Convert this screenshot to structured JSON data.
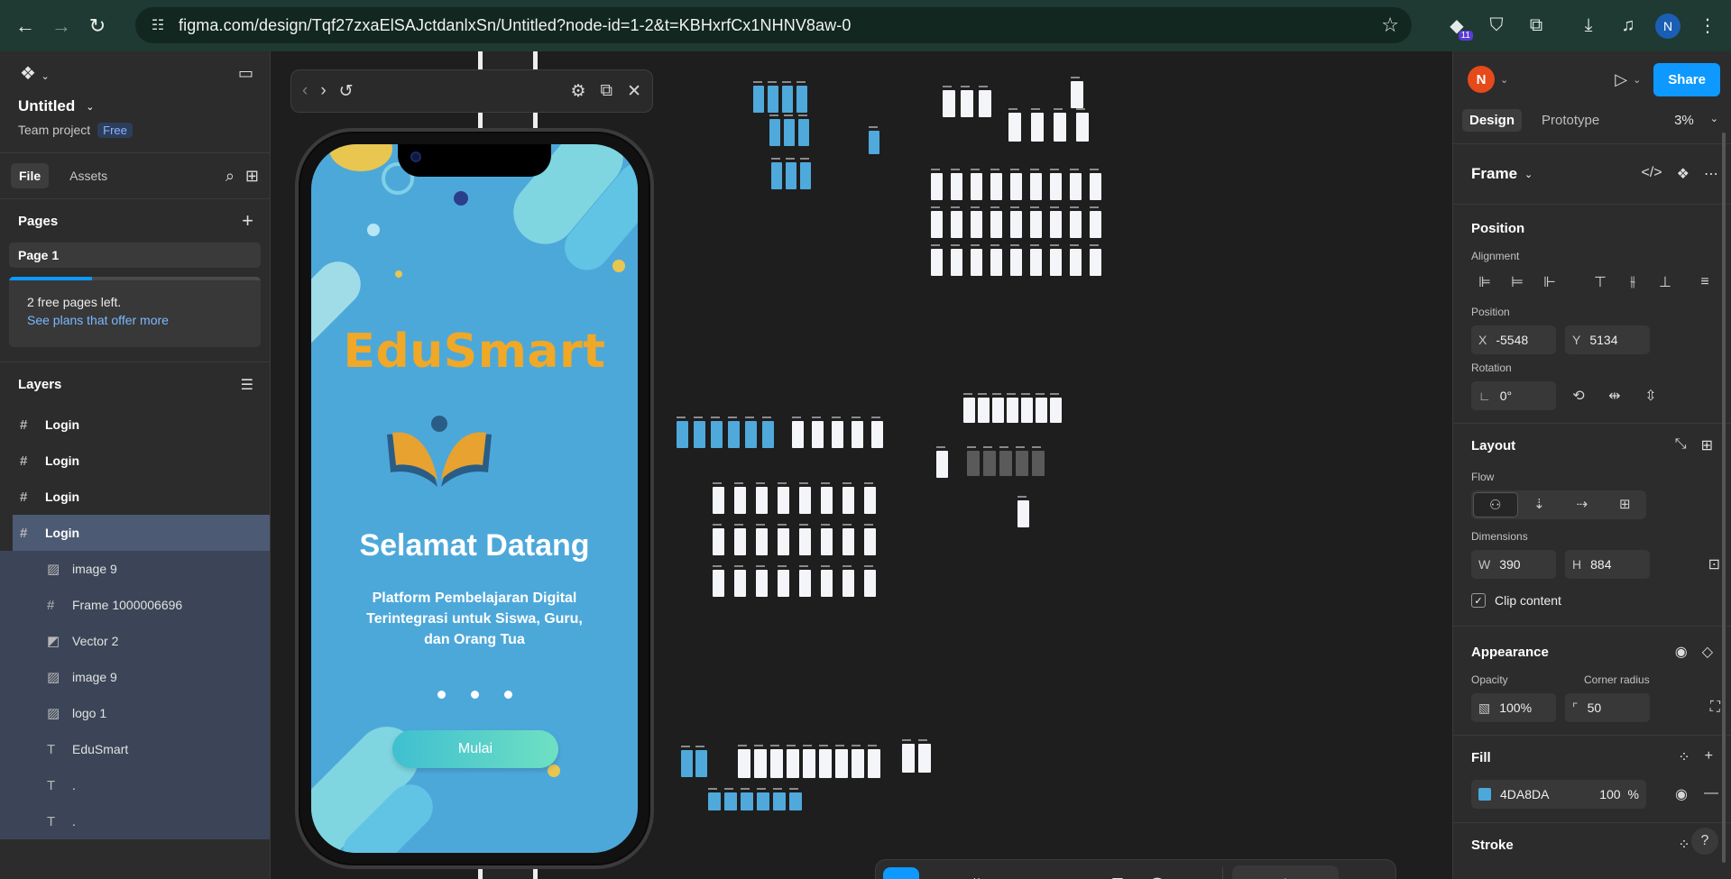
{
  "browser": {
    "url": "figma.com/design/Tqf27zxaElSAJctdanlxSn/Untitled?node-id=1-2&t=KBHxrfCx1NHNV8aw-0",
    "extension_badge": "11",
    "profile_initial": "N",
    "icons": [
      "back-icon",
      "forward-icon",
      "reload-icon",
      "site-settings-icon",
      "star-icon",
      "extension-icon",
      "shield-icon",
      "puzzle-icon",
      "download-icon",
      "media-icon"
    ]
  },
  "file": {
    "title": "Untitled",
    "team": "Team project",
    "plan_badge": "Free"
  },
  "left_tabs": {
    "file": "File",
    "assets": "Assets"
  },
  "pages": {
    "header": "Pages",
    "items": [
      {
        "label": "Page 1"
      }
    ],
    "notice_line1": "2 free pages left.",
    "notice_line2": "See plans that offer more",
    "usage_fraction": 0.33
  },
  "layers": {
    "header": "Layers",
    "items": [
      {
        "icon": "#",
        "label": "Login",
        "level": 0
      },
      {
        "icon": "#",
        "label": "Login",
        "level": 0
      },
      {
        "icon": "#",
        "label": "Login",
        "level": 0
      },
      {
        "icon": "#",
        "label": "Login",
        "level": 0,
        "selected": true
      },
      {
        "icon": "▨",
        "label": "image 9",
        "level": 1
      },
      {
        "icon": "#",
        "label": "Frame 1000006696",
        "level": 1
      },
      {
        "icon": "◩",
        "label": "Vector 2",
        "level": 1
      },
      {
        "icon": "▨",
        "label": "image 9",
        "level": 1
      },
      {
        "icon": "▨",
        "label": "logo 1",
        "level": 1
      },
      {
        "icon": "T",
        "label": "EduSmart",
        "level": 1
      },
      {
        "icon": "T",
        "label": ".",
        "level": 1
      },
      {
        "icon": "T",
        "label": ".",
        "level": 1
      }
    ]
  },
  "preview": {
    "brand": "EduSmart",
    "welcome": "Selamat Datang",
    "subtitle": "Platform Pembelajaran Digital Terintegrasi untuk Siswa, Guru, dan Orang Tua",
    "start_button": "Mulai",
    "bg_color": "#4DA8DA",
    "brand_color": "#F0A826"
  },
  "toolbar": {
    "tools": [
      "move-tool",
      "frame-tool",
      "shape-tool",
      "pen-tool",
      "text-tool",
      "comment-tool",
      "actions-tool"
    ],
    "modes": [
      "draw-mode",
      "design-mode",
      "dev-mode"
    ]
  },
  "right_panel": {
    "avatar_initial": "N",
    "share_label": "Share",
    "tab_design": "Design",
    "tab_prototype": "Prototype",
    "zoom": "3%",
    "selection_type": "Frame",
    "position": {
      "title": "Position",
      "alignment_label": "Alignment",
      "position_label": "Position",
      "x_label": "X",
      "x_value": "-5548",
      "y_label": "Y",
      "y_value": "5134",
      "rotation_label": "Rotation",
      "rotation_value": "0°"
    },
    "layout": {
      "title": "Layout",
      "flow_label": "Flow",
      "dimensions_label": "Dimensions",
      "w_label": "W",
      "w_value": "390",
      "h_label": "H",
      "h_value": "884",
      "clip_label": "Clip content",
      "clip_checked": true
    },
    "appearance": {
      "title": "Appearance",
      "opacity_label": "Opacity",
      "opacity_value": "100%",
      "radius_label": "Corner radius",
      "radius_value": "50"
    },
    "fill": {
      "title": "Fill",
      "hex": "4DA8DA",
      "opacity": "100",
      "unit": "%",
      "swatch_color": "#4DA8DA"
    },
    "stroke": {
      "title": "Stroke"
    }
  }
}
